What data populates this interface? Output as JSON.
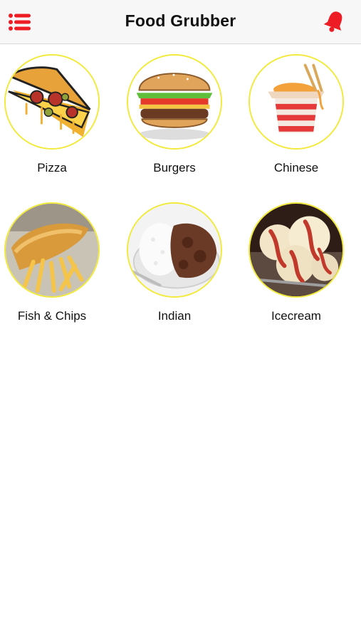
{
  "app": {
    "title": "Food Grubber"
  },
  "header": {
    "menu_icon": "list-menu-icon",
    "bell_icon": "bell-icon",
    "accent": "#ee1c24"
  },
  "categories": [
    {
      "label": "Pizza",
      "icon": "pizza-slice"
    },
    {
      "label": "Burgers",
      "icon": "burger"
    },
    {
      "label": "Chinese",
      "icon": "noodle-box"
    },
    {
      "label": "Fish & Chips",
      "icon": "fish-and-chips"
    },
    {
      "label": "Indian",
      "icon": "curry-rice"
    },
    {
      "label": "Icecream",
      "icon": "ice-cream"
    }
  ],
  "colors": {
    "circle_border": "#f2ea3a",
    "header_bg": "#f7f7f7"
  }
}
